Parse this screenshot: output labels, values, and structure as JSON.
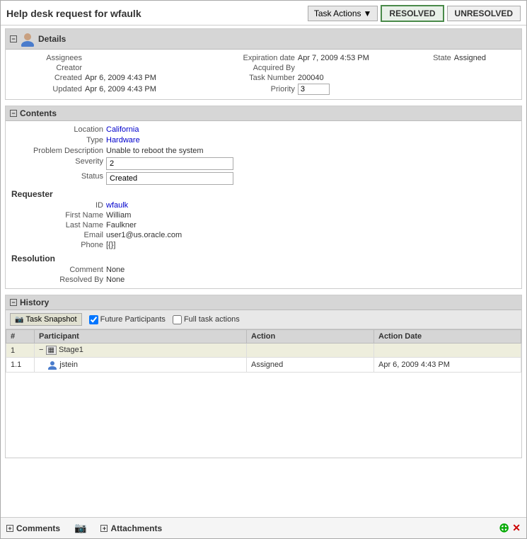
{
  "page": {
    "title": "Help desk request for wfaulk"
  },
  "header": {
    "task_actions_label": "Task Actions",
    "resolved_label": "RESOLVED",
    "unresolved_label": "UNRESOLVED"
  },
  "details": {
    "section_title": "Details",
    "assignees_label": "Assignees",
    "creator_label": "Creator",
    "created_label": "Created",
    "updated_label": "Updated",
    "expiration_label": "Expiration date",
    "acquired_label": "Acquired By",
    "task_number_label": "Task Number",
    "priority_label": "Priority",
    "state_label": "State",
    "expiration_value": "Apr 7, 2009 4:53 PM",
    "created_value": "Apr 6, 2009 4:43 PM",
    "updated_value": "Apr 6, 2009 4:43 PM",
    "task_number_value": "200040",
    "priority_value": "3",
    "state_value": "Assigned"
  },
  "contents": {
    "section_title": "Contents",
    "location_label": "Location",
    "type_label": "Type",
    "problem_desc_label": "Problem Description",
    "severity_label": "Severity",
    "status_label": "Status",
    "location_value": "California",
    "type_value": "Hardware",
    "problem_desc_value": "Unable to reboot the system",
    "severity_value": "2",
    "status_value": "Created"
  },
  "requester": {
    "section_title": "Requester",
    "id_label": "ID",
    "first_name_label": "First Name",
    "last_name_label": "Last Name",
    "email_label": "Email",
    "phone_label": "Phone",
    "id_value": "wfaulk",
    "first_name_value": "William",
    "last_name_value": "Faulkner",
    "email_value": "user1@us.oracle.com",
    "phone_value": "[{}]"
  },
  "resolution": {
    "section_title": "Resolution",
    "comment_label": "Comment",
    "resolved_by_label": "Resolved By",
    "comment_value": "None",
    "resolved_by_value": "None"
  },
  "history": {
    "section_title": "History",
    "task_snapshot_label": "Task Snapshot",
    "future_participants_label": "Future Participants",
    "full_task_actions_label": "Full task actions",
    "col_number": "#",
    "col_participant": "Participant",
    "col_action": "Action",
    "col_action_date": "Action Date",
    "row1": {
      "number": "1",
      "participant": "Stage1",
      "action": "",
      "action_date": ""
    },
    "row1_1": {
      "number": "1.1",
      "participant": "jstein",
      "action": "Assigned",
      "action_date": "Apr 6, 2009 4:43 PM"
    }
  },
  "bottom": {
    "comments_label": "Comments",
    "attachments_label": "Attachments"
  }
}
